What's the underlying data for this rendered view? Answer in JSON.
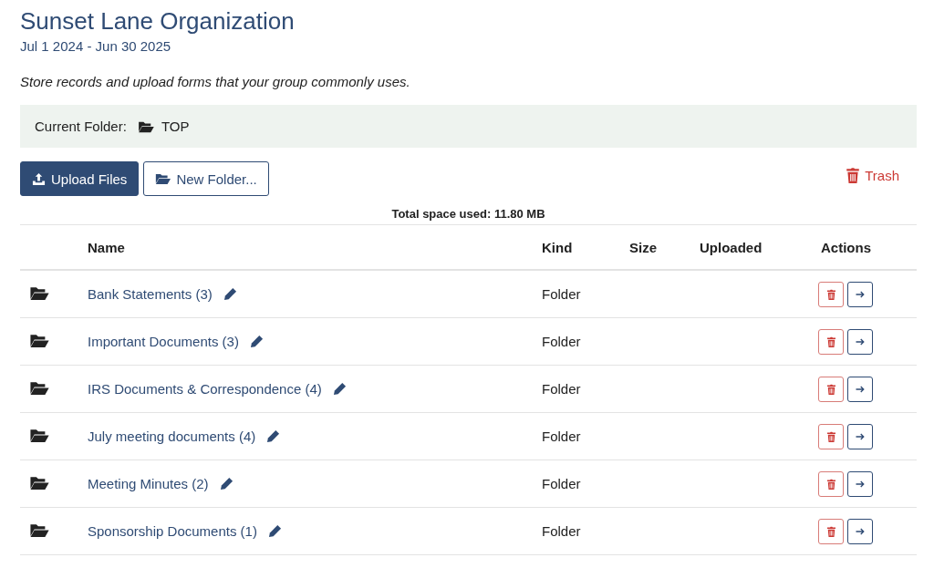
{
  "header": {
    "title": "Sunset Lane Organization",
    "date_range": "Jul 1 2024 - Jun 30 2025",
    "description": "Store records and upload forms that your group commonly uses."
  },
  "current_folder": {
    "label": "Current Folder:",
    "name": "TOP"
  },
  "toolbar": {
    "upload_button": "Upload Files",
    "new_folder_button": "New Folder...",
    "trash_link": "Trash"
  },
  "total_space": "Total space used: 11.80 MB",
  "table": {
    "columns": [
      "Name",
      "Kind",
      "Size",
      "Uploaded",
      "Actions"
    ],
    "rows": [
      {
        "name": "Bank Statements (3)",
        "kind": "Folder"
      },
      {
        "name": "Important Documents (3)",
        "kind": "Folder"
      },
      {
        "name": "IRS Documents & Correspondence (4)",
        "kind": "Folder"
      },
      {
        "name": "July meeting documents (4)",
        "kind": "Folder"
      },
      {
        "name": "Meeting Minutes (2)",
        "kind": "Folder"
      },
      {
        "name": "Sponsorship Documents (1)",
        "kind": "Folder"
      }
    ]
  }
}
